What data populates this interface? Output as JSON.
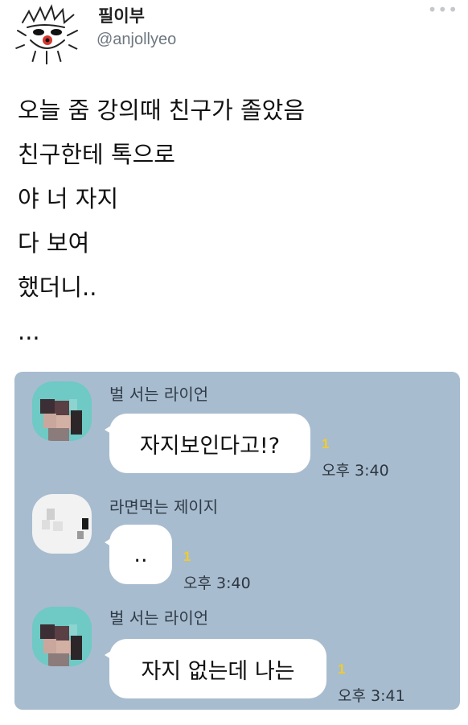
{
  "tweet": {
    "display_name": "필이부",
    "handle": "@anjollyeo",
    "more_icon": "more-dots-icon",
    "lines": [
      "오늘 줌 강의때 친구가 졸았음",
      "친구한테 톡으로",
      "야 너 자지",
      "다 보여",
      "했더니..",
      "..."
    ]
  },
  "chat": {
    "background_color": "#a8bccf",
    "messages": [
      {
        "sender": "벌 서는 라이언",
        "text": "자지보인다고!?",
        "unread": "1",
        "time": "오후 3:40"
      },
      {
        "sender": "라면먹는 제이지",
        "text": "..",
        "unread": "1",
        "time": "오후 3:40"
      },
      {
        "sender": "벌 서는 라이언",
        "text": "자지 없는데 나는",
        "unread": "1",
        "time": "오후 3:41"
      }
    ]
  }
}
